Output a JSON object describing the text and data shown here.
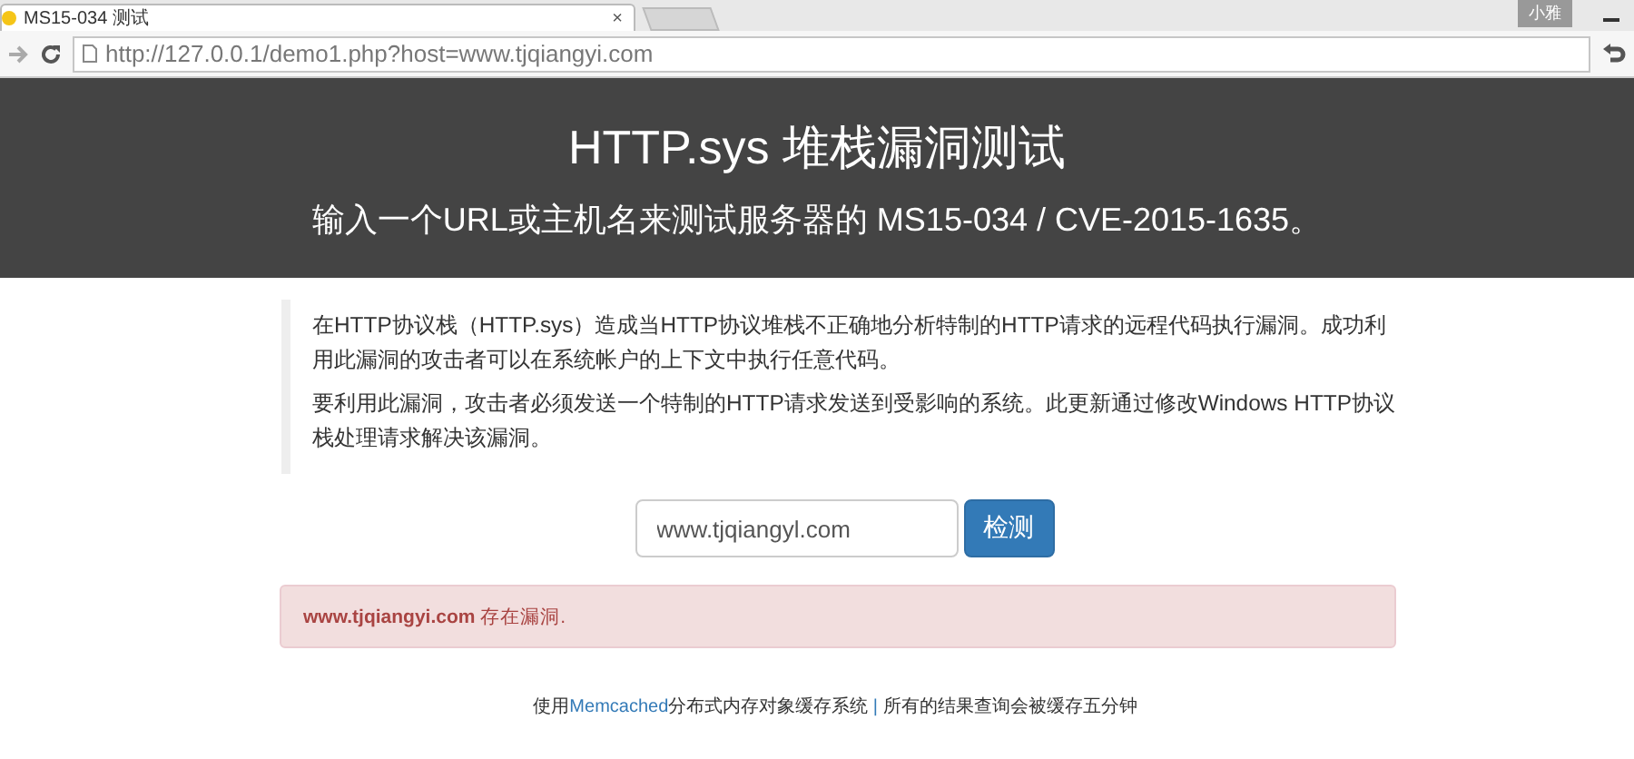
{
  "browser": {
    "tab": {
      "title": "MS15-034 测试",
      "close": "×",
      "selected": true
    },
    "user_badge": "小雅",
    "address": "http://127.0.0.1/demo1.php?host=www.tjqiangyi.com"
  },
  "header": {
    "title": "HTTP.sys 堆栈漏洞测试",
    "subtitle": "输入一个URL或主机名来测试服务器的 MS15-034 / CVE-2015-1635。"
  },
  "description": [
    "在HTTP协议栈（HTTP.sys）造成当HTTP协议堆栈不正确地分析特制的HTTP请求的远程代码执行漏洞。成功利用此漏洞的攻击者可以在系统帐户的上下文中执行任意代码。",
    "要利用此漏洞，攻击者必须发送一个特制的HTTP请求发送到受影响的系统。此更新通过修改Windows HTTP协议栈处理请求解决该漏洞。"
  ],
  "form": {
    "value": "www.tjqiangyl.com",
    "button": "检测"
  },
  "alert": {
    "text": "**www.tjqiangyi.com** 存在漏洞."
  },
  "footer": {
    "prefix": "使用",
    "link": "Memcached",
    "suffix": "分布式内存对象缓存系统",
    "separator": "|",
    "note": "所有的结果查询会被缓存五分钟"
  }
}
